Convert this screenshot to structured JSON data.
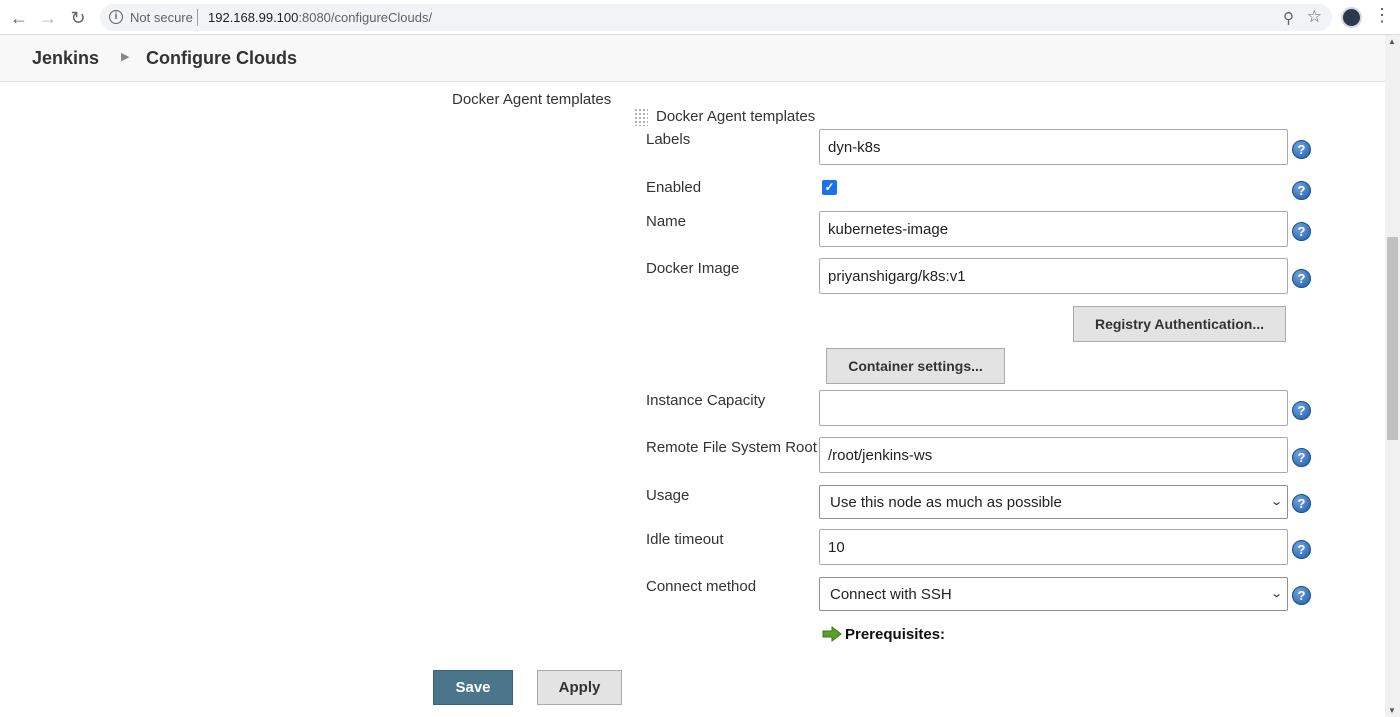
{
  "browser": {
    "back_icon": "arrow-left-icon",
    "forward_icon": "arrow-right-icon",
    "reload_icon": "reload-icon",
    "security_label": "Not secure",
    "url_host": "192.168.99.100",
    "url_rest": ":8080/configureClouds/"
  },
  "header": {
    "root": "Jenkins",
    "page": "Configure Clouds"
  },
  "form": {
    "section_label": "Docker Agent templates",
    "block_title": "Docker Agent templates",
    "labels": {
      "label": "Labels",
      "value": "dyn-k8s"
    },
    "enabled": {
      "label": "Enabled",
      "checked": true
    },
    "name": {
      "label": "Name",
      "value": "kubernetes-image"
    },
    "docker_image": {
      "label": "Docker Image",
      "value": "priyanshigarg/k8s:v1"
    },
    "registry_button": "Registry Authentication...",
    "container_button": "Container settings...",
    "instance_capacity": {
      "label": "Instance Capacity",
      "value": ""
    },
    "remote_fs_root": {
      "label": "Remote File System Root",
      "value": "/root/jenkins-ws"
    },
    "usage": {
      "label": "Usage",
      "value": "Use this node as much as possible"
    },
    "idle_timeout": {
      "label": "Idle timeout",
      "value": "10"
    },
    "connect_method": {
      "label": "Connect method",
      "value": "Connect with SSH"
    },
    "prerequisites": "Prerequisites:"
  },
  "actions": {
    "save": "Save",
    "apply": "Apply"
  },
  "colors": {
    "save_bg": "#4b758b",
    "help_blue": "#1f5ea8",
    "checkbox_blue": "#1a73e8"
  }
}
